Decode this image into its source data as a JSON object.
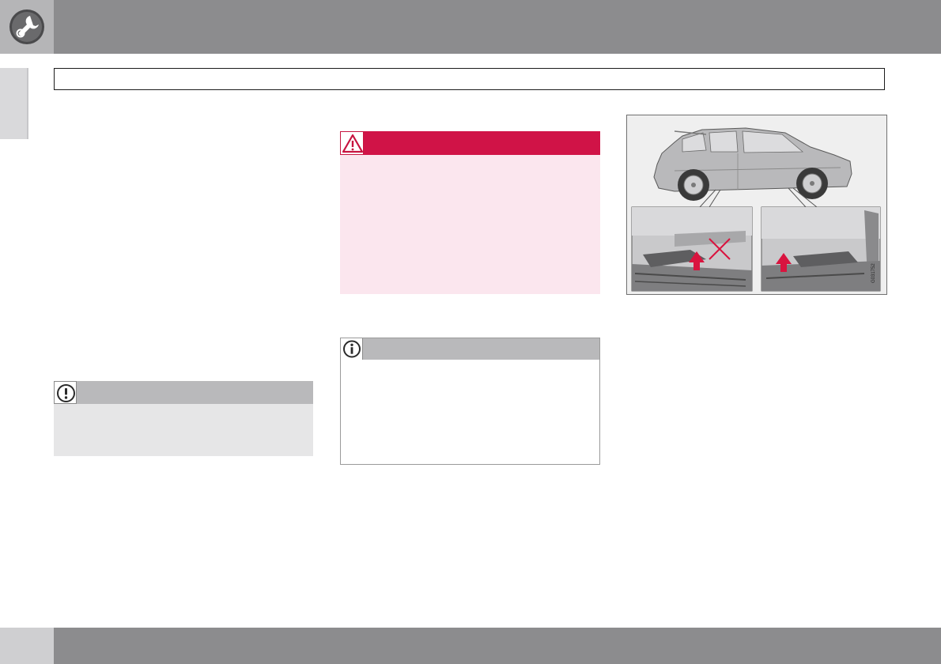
{
  "header": {
    "section_icon": "wrench-gear-icon",
    "section_title": ""
  },
  "notes": {
    "important": {
      "icon": "exclamation-icon"
    },
    "warning": {
      "icon": "warning-triangle-icon"
    },
    "info": {
      "icon": "info-icon"
    }
  },
  "figure": {
    "image_code": "G031752",
    "subject": "car-lifting-points-illustration",
    "colors": {
      "arrow": "#d9143f",
      "cross": "#d9143f"
    }
  },
  "colors": {
    "header_bar": "#8c8c8e",
    "warning_header": "#d01347",
    "warning_body": "#fbe6ee",
    "note_header": "#b9b9bb"
  }
}
